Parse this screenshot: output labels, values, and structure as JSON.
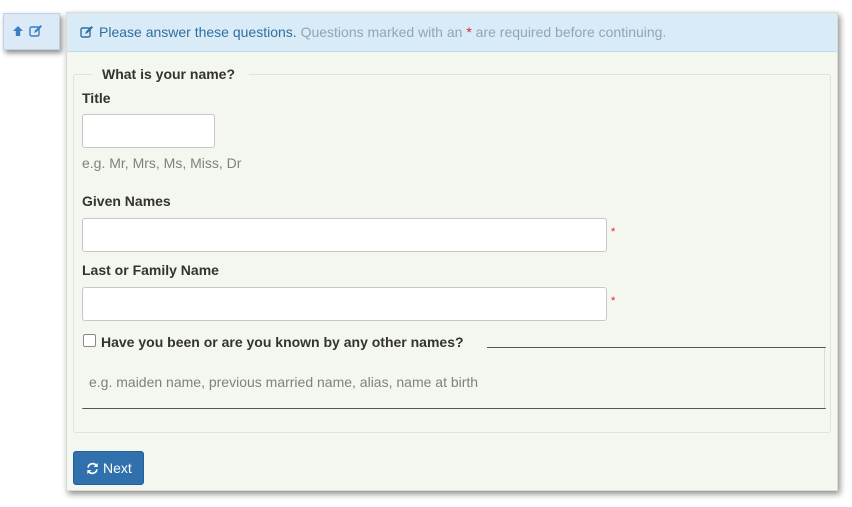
{
  "sidebar": {
    "icons": [
      "arrow-up-icon",
      "edit-icon"
    ]
  },
  "alert": {
    "icon": "edit-icon",
    "main": "Please answer these questions.",
    "sub_before": "Questions marked with an",
    "required_marker": "*",
    "sub_after": "are required before continuing."
  },
  "form": {
    "legend": "What is your name?",
    "title": {
      "label": "Title",
      "value": "",
      "help": "e.g. Mr, Mrs, Ms, Miss, Dr"
    },
    "given_names": {
      "label": "Given Names",
      "value": "",
      "required_marker": "*"
    },
    "last_name": {
      "label": "Last or Family Name",
      "value": "",
      "required_marker": "*"
    },
    "other_names": {
      "label": "Have you been or are you known by any other names?",
      "checked": false,
      "help": "e.g. maiden name, previous married name, alias, name at birth"
    }
  },
  "actions": {
    "next_icon": "refresh-icon",
    "next_label": "Next"
  },
  "colors": {
    "accent": "#2f70ad",
    "alert_bg": "#d9ebf7",
    "panel_bg": "#f4f6f0",
    "required": "#d9262b"
  }
}
